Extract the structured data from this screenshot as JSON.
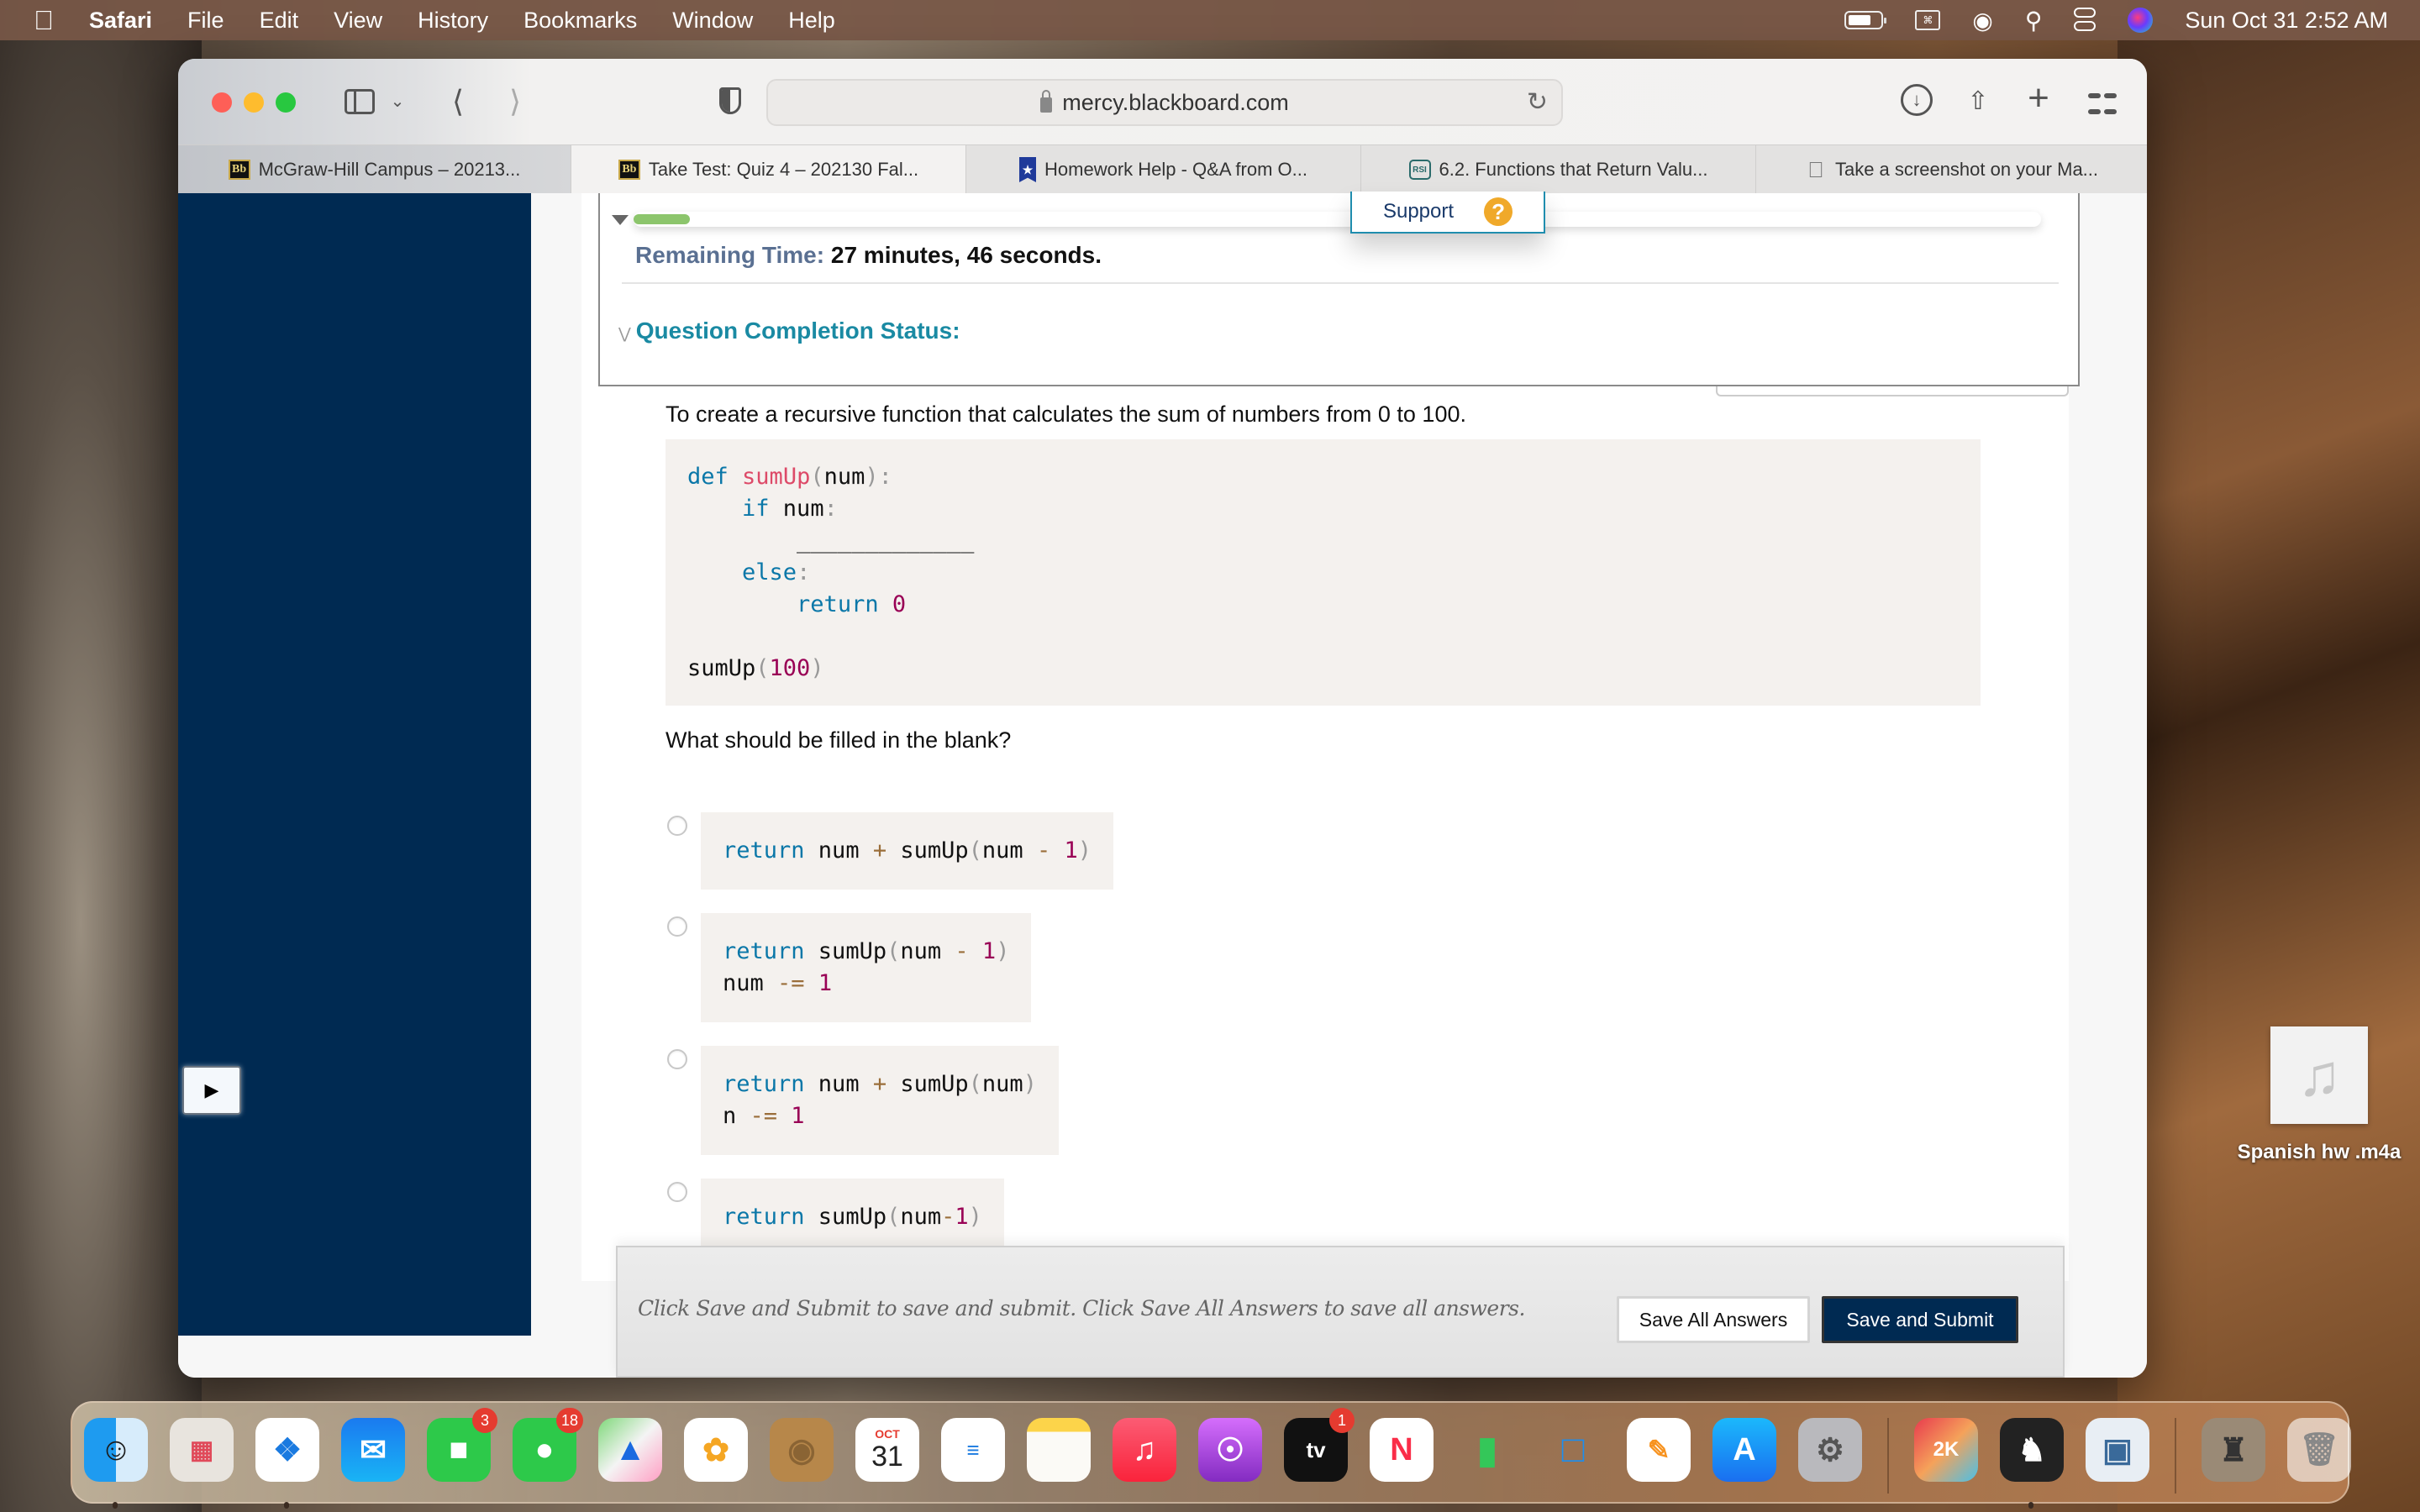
{
  "menubar": {
    "app": "Safari",
    "items": [
      "File",
      "Edit",
      "View",
      "History",
      "Bookmarks",
      "Window",
      "Help"
    ],
    "datetime": "Sun Oct 31  2:52 AM",
    "status_icons": [
      "battery-icon",
      "keyboard-viewer-icon",
      "wifi-icon",
      "spotlight-search-icon",
      "control-center-icon",
      "siri-icon"
    ]
  },
  "browser": {
    "url": "mercy.blackboard.com",
    "tabs": [
      {
        "label": "McGraw-Hill Campus – 20213...",
        "icon": "blackboard-icon",
        "active": false
      },
      {
        "label": "Take Test: Quiz 4 – 202130 Fal...",
        "icon": "blackboard-icon",
        "active": true
      },
      {
        "label": "Homework Help - Q&A from O...",
        "icon": "course-hero-icon",
        "active": false
      },
      {
        "label": "6.2. Functions that Return Valu...",
        "icon": "rsi-icon",
        "active": false
      },
      {
        "label": "Take a screenshot on your Ma...",
        "icon": "apple-icon",
        "active": false
      }
    ]
  },
  "test": {
    "support_label": "Support",
    "progress_fraction": 0.04,
    "remaining_label": "Remaining Time:",
    "remaining_value": "27 minutes, 46 seconds.",
    "completion_label": "Question Completion Status:",
    "question_text": "To create a recursive function that calculates the sum of numbers from 0 to 100.",
    "code_lines": [
      "def sumUp(num):",
      "    if num:",
      "        _____________",
      "    else:",
      "        return 0",
      "",
      "sumUp(100)"
    ],
    "prompt": "What should be filled in the blank?",
    "options": [
      {
        "lines": [
          "return num + sumUp(num - 1)"
        ],
        "selected": false
      },
      {
        "lines": [
          "return sumUp(num - 1)",
          "num -= 1"
        ],
        "selected": false
      },
      {
        "lines": [
          "return num + sumUp(num)",
          "n -= 1"
        ],
        "selected": false
      },
      {
        "lines": [
          "return sumUp(num-1)"
        ],
        "selected": false
      }
    ],
    "footer_message": "Click Save and Submit to save and submit. Click Save All Answers to save all answers.",
    "save_all_label": "Save All Answers",
    "submit_label": "Save and Submit"
  },
  "desktop": {
    "file_name": "Spanish hw .m4a"
  },
  "dock": {
    "apps": [
      {
        "name": "Finder",
        "running": true
      },
      {
        "name": "Launchpad"
      },
      {
        "name": "Safari",
        "running": true
      },
      {
        "name": "Mail"
      },
      {
        "name": "FaceTime",
        "badge": "3"
      },
      {
        "name": "Messages",
        "badge": "18"
      },
      {
        "name": "Maps"
      },
      {
        "name": "Photos"
      },
      {
        "name": "Contacts"
      },
      {
        "name": "Calendar",
        "month": "OCT",
        "day": "31"
      },
      {
        "name": "Reminders"
      },
      {
        "name": "Notes"
      },
      {
        "name": "Music"
      },
      {
        "name": "Podcasts"
      },
      {
        "name": "TV",
        "badge": "1"
      },
      {
        "name": "News"
      },
      {
        "name": "Numbers"
      },
      {
        "name": "Keynote"
      },
      {
        "name": "Pages"
      },
      {
        "name": "App Store"
      },
      {
        "name": "System Preferences"
      },
      {
        "name": "NBA 2K21"
      },
      {
        "name": "Chess",
        "running": true
      },
      {
        "name": "Preview"
      },
      {
        "name": "Chess window"
      },
      {
        "name": "Trash"
      }
    ]
  }
}
